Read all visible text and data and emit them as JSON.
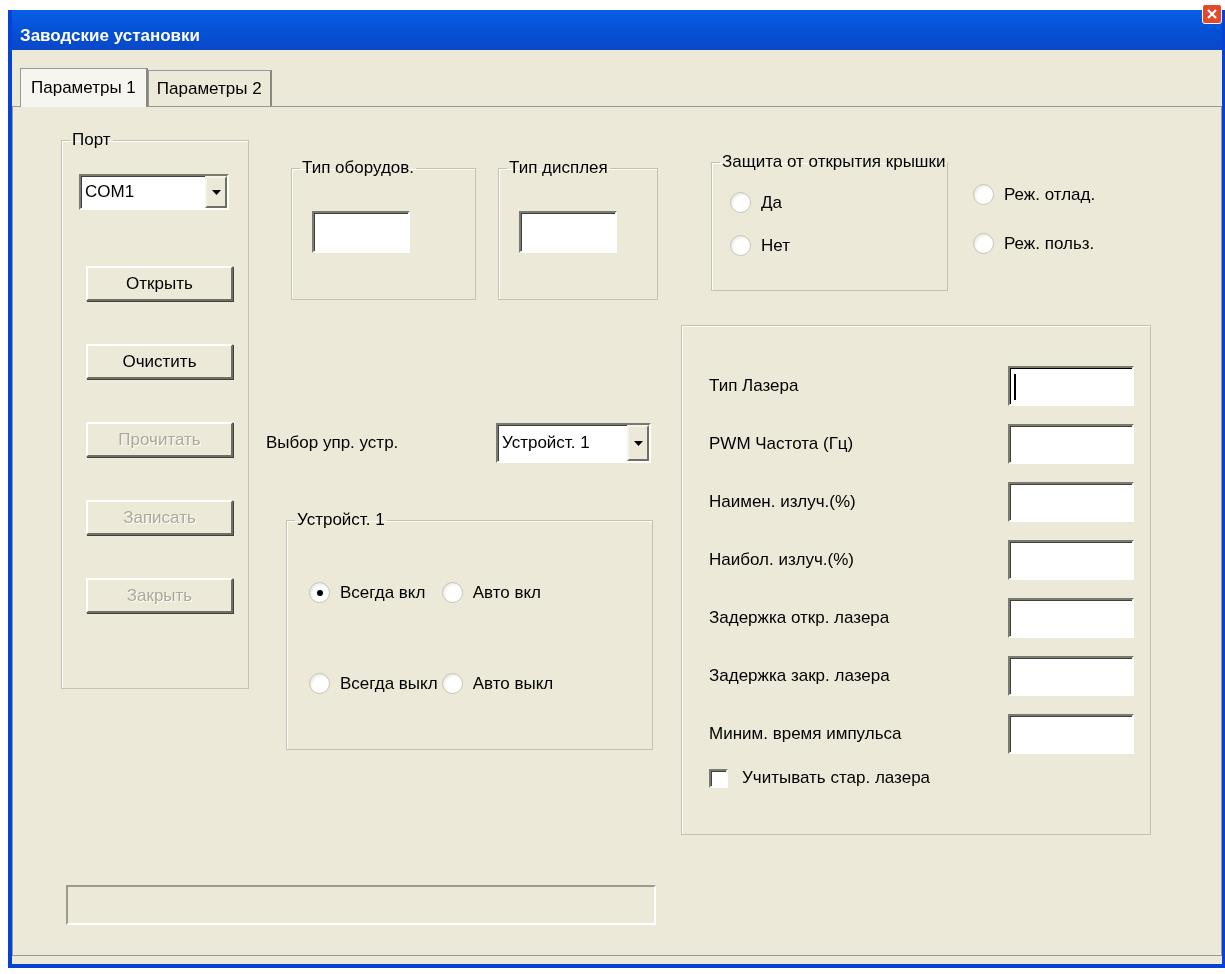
{
  "window": {
    "title": "Заводские установки"
  },
  "tabs": [
    {
      "label": "Параметры 1",
      "selected": true
    },
    {
      "label": "Параметры 2",
      "selected": false
    }
  ],
  "port": {
    "title": "Порт",
    "combo": {
      "value": "COM1"
    },
    "buttons": [
      {
        "label": "Открыть",
        "disabled": false
      },
      {
        "label": "Очистить",
        "disabled": false
      },
      {
        "label": "Прочитать",
        "disabled": true
      },
      {
        "label": "Записать",
        "disabled": true
      },
      {
        "label": "Закрыть",
        "disabled": true
      }
    ]
  },
  "type_groups": [
    {
      "title": "Тип оборудов."
    },
    {
      "title": "Тип дисплея"
    }
  ],
  "lid_protection": {
    "title": "Защита от открытия крышки",
    "options": [
      {
        "label": "Да",
        "selected": false
      },
      {
        "label": "Нет",
        "selected": false
      }
    ]
  },
  "mode": {
    "options": [
      {
        "label": "Реж. отлад.",
        "selected": false
      },
      {
        "label": "Реж. польз.",
        "selected": false
      }
    ]
  },
  "device_select": {
    "label": "Выбор упр. устр.",
    "value": "Устройст. 1"
  },
  "device_group": {
    "title": "Устройст. 1",
    "options": [
      {
        "label": "Всегда вкл",
        "selected": true
      },
      {
        "label": "Авто вкл",
        "selected": false
      },
      {
        "label": "Всегда выкл",
        "selected": false
      },
      {
        "label": "Авто выкл",
        "selected": false
      }
    ]
  },
  "laser": {
    "fields": [
      {
        "label": "Тип Лазера",
        "focused": true
      },
      {
        "label": "PWM Частота (Гц)",
        "focused": false
      },
      {
        "label": "Наимен. излуч.(%)",
        "focused": false
      },
      {
        "label": "Наибол. излуч.(%)",
        "focused": false
      },
      {
        "label": "Задержка откр. лазера",
        "focused": false
      },
      {
        "label": "Задержка закр. лазера",
        "focused": false
      },
      {
        "label": "Миним. время импульса",
        "focused": false
      }
    ],
    "checkbox": {
      "label": "Учитывать стар. лазера",
      "checked": false
    }
  }
}
